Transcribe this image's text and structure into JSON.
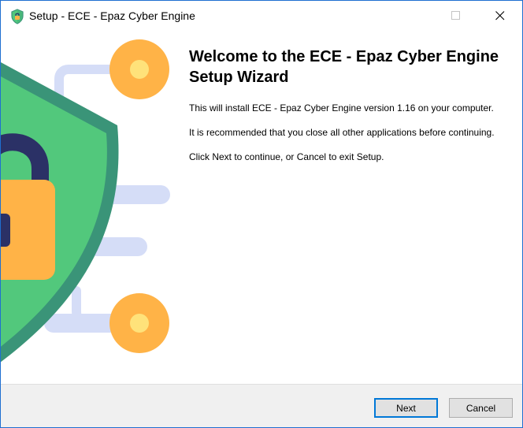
{
  "window": {
    "title": "Setup - ECE - Epaz Cyber Engine",
    "app_icon": "shield-icon",
    "controls": [
      "maximize-icon",
      "close-icon"
    ]
  },
  "welcome": {
    "title": "Welcome to the ECE - Epaz Cyber Engine Setup Wizard",
    "line1": "This will install ECE - Epaz Cyber Engine version 1.16 on your computer.",
    "line2": "It is recommended that you close all other applications before continuing.",
    "line3": "Click Next to continue, or Cancel to exit Setup."
  },
  "buttons": {
    "next": "Next",
    "cancel": "Cancel"
  },
  "colors": {
    "shield_green": "#52c87c",
    "shield_border": "#3a9478",
    "lock_orange": "#ffb347",
    "lock_shackle": "#2b3166",
    "circuit_line": "#d5ddf7",
    "node_orange": "#ffb347",
    "node_center": "#ffe27a",
    "accent_blue": "#0078d7"
  }
}
